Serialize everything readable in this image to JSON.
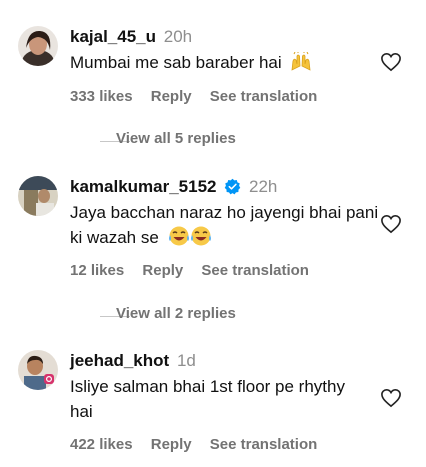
{
  "colors": {
    "text": "#111111",
    "muted": "#737373",
    "verified": "#0095f6",
    "divider": "#c7c7c7"
  },
  "comments": [
    {
      "username": "kajal_45_u",
      "time": "20h",
      "verified": false,
      "text": "Mumbai me sab baraber hai",
      "emoji": "raised-hands-icon",
      "likes": "333 likes",
      "reply": "Reply",
      "translate": "See translation"
    },
    {
      "username": "kamalkumar_5152",
      "time": "22h",
      "verified": true,
      "text": "Jaya bacchan naraz ho jayengi bhai pani ki wazah se",
      "emoji": "laughing-tears-icon",
      "likes": "12 likes",
      "reply": "Reply",
      "translate": "See translation"
    },
    {
      "username": "jeehad_khot",
      "time": "1d",
      "verified": false,
      "text": "Isliye salman bhai 1st floor pe rhythy hai",
      "emoji": "",
      "likes": "422 likes",
      "reply": "Reply",
      "translate": "See translation"
    }
  ],
  "reply_threads": [
    {
      "label": "View all 5 replies"
    },
    {
      "label": "View all 2 replies"
    }
  ]
}
